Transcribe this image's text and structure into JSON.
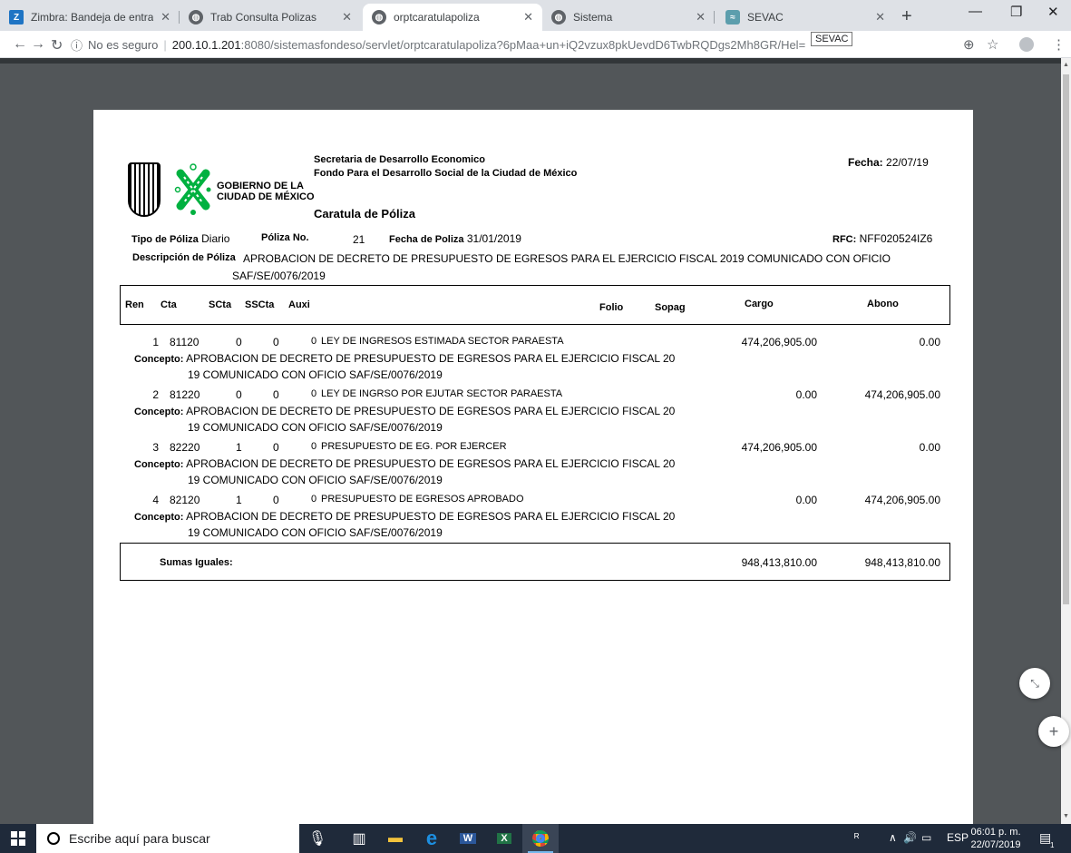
{
  "browser": {
    "tabs": [
      {
        "title": "Zimbra: Bandeja de entrada",
        "favicon": "zimbra-icon"
      },
      {
        "title": "Trab Consulta Polizas",
        "favicon": "globe-icon"
      },
      {
        "title": "orptcaratulapoliza",
        "favicon": "globe-icon"
      },
      {
        "title": "Sistema",
        "favicon": "globe-icon"
      },
      {
        "title": "SEVAC",
        "favicon": "sevac-icon"
      }
    ],
    "address": {
      "security": "No es seguro",
      "host": "200.10.1.201",
      "path": ":8080/sistemasfondeso/servlet/orptcaratulapoliza?6pMaa+un+iQ2vzux8pkUevdD6TwbRQDgs2Mh8GR/Hel="
    },
    "tooltip": "SEVAC"
  },
  "document": {
    "logo_line1": "GOBIERNO DE LA",
    "logo_line2": "CIUDAD DE MÉXICO",
    "org_line1": "Secretaria de Desarrollo Economico",
    "org_line2": "Fondo Para el Desarrollo Social de la Ciudad de México",
    "title": "Caratula de Póliza",
    "fecha_label": "Fecha:",
    "fecha_value": "22/07/19",
    "tipo_label": "Tipo de Póliza",
    "tipo_value": "Diario",
    "poliza_label": "Póliza No.",
    "poliza_value": "21",
    "fecha_poliza_label": "Fecha de Poliza",
    "fecha_poliza_value": "31/01/2019",
    "rfc_label": "RFC:",
    "rfc_value": "NFF020524IZ6",
    "descripcion_label": "Descripción de Póliza",
    "descripcion_line1": "APROBACION DE DECRETO DE PRESUPUESTO DE EGRESOS PARA EL EJERCICIO FISCAL 2019 COMUNICADO CON OFICIO",
    "descripcion_line2": "SAF/SE/0076/2019",
    "columns": {
      "ren": "Ren",
      "cta": "Cta",
      "scta": "SCta",
      "sscta": "SSCta",
      "auxi": "Auxi",
      "folio": "Folio",
      "sopag": "Sopag",
      "cargo": "Cargo",
      "abono": "Abono"
    },
    "concepto_label": "Concepto:",
    "rows": [
      {
        "ren": "1",
        "cta": "81120",
        "scta": "0",
        "sscta": "0",
        "auxi": "0",
        "descripcion": "LEY DE INGRESOS ESTIMADA SECTOR PARAESTA",
        "cargo": "474,206,905.00",
        "abono": "0.00",
        "concepto1": "APROBACION DE DECRETO DE PRESUPUESTO DE EGRESOS PARA EL EJERCICIO FISCAL 20",
        "concepto2": "19 COMUNICADO CON OFICIO SAF/SE/0076/2019"
      },
      {
        "ren": "2",
        "cta": "81220",
        "scta": "0",
        "sscta": "0",
        "auxi": "0",
        "descripcion": "LEY DE INGRSO POR EJUTAR SECTOR PARAESTA",
        "cargo": "0.00",
        "abono": "474,206,905.00",
        "concepto1": "APROBACION DE DECRETO DE PRESUPUESTO DE EGRESOS PARA EL EJERCICIO FISCAL 20",
        "concepto2": "19 COMUNICADO CON OFICIO SAF/SE/0076/2019"
      },
      {
        "ren": "3",
        "cta": "82220",
        "scta": "1",
        "sscta": "0",
        "auxi": "0",
        "descripcion": "PRESUPUESTO DE EG. POR EJERCER",
        "cargo": "474,206,905.00",
        "abono": "0.00",
        "concepto1": "APROBACION DE DECRETO DE PRESUPUESTO DE EGRESOS PARA EL EJERCICIO FISCAL 20",
        "concepto2": "19 COMUNICADO CON OFICIO SAF/SE/0076/2019"
      },
      {
        "ren": "4",
        "cta": "82120",
        "scta": "1",
        "sscta": "0",
        "auxi": "0",
        "descripcion": "PRESUPUESTO DE EGRESOS APROBADO",
        "cargo": "0.00",
        "abono": "474,206,905.00",
        "concepto1": "APROBACION DE DECRETO DE PRESUPUESTO DE EGRESOS PARA EL EJERCICIO FISCAL 20",
        "concepto2": "19 COMUNICADO CON OFICIO SAF/SE/0076/2019"
      }
    ],
    "sumas_label": "Sumas Iguales:",
    "sumas_cargo": "948,413,810.00",
    "sumas_abono": "948,413,810.00"
  },
  "taskbar": {
    "search_placeholder": "Escribe aquí para buscar",
    "language": "ESP",
    "time": "06:01 p. m.",
    "date": "22/07/2019",
    "notification_count": "1"
  },
  "colors": {
    "logo_green": "#00b140",
    "chrome_bg": "#dee1e6",
    "viewer_bg": "#525659",
    "taskbar_bg": "#1f2a3a"
  }
}
